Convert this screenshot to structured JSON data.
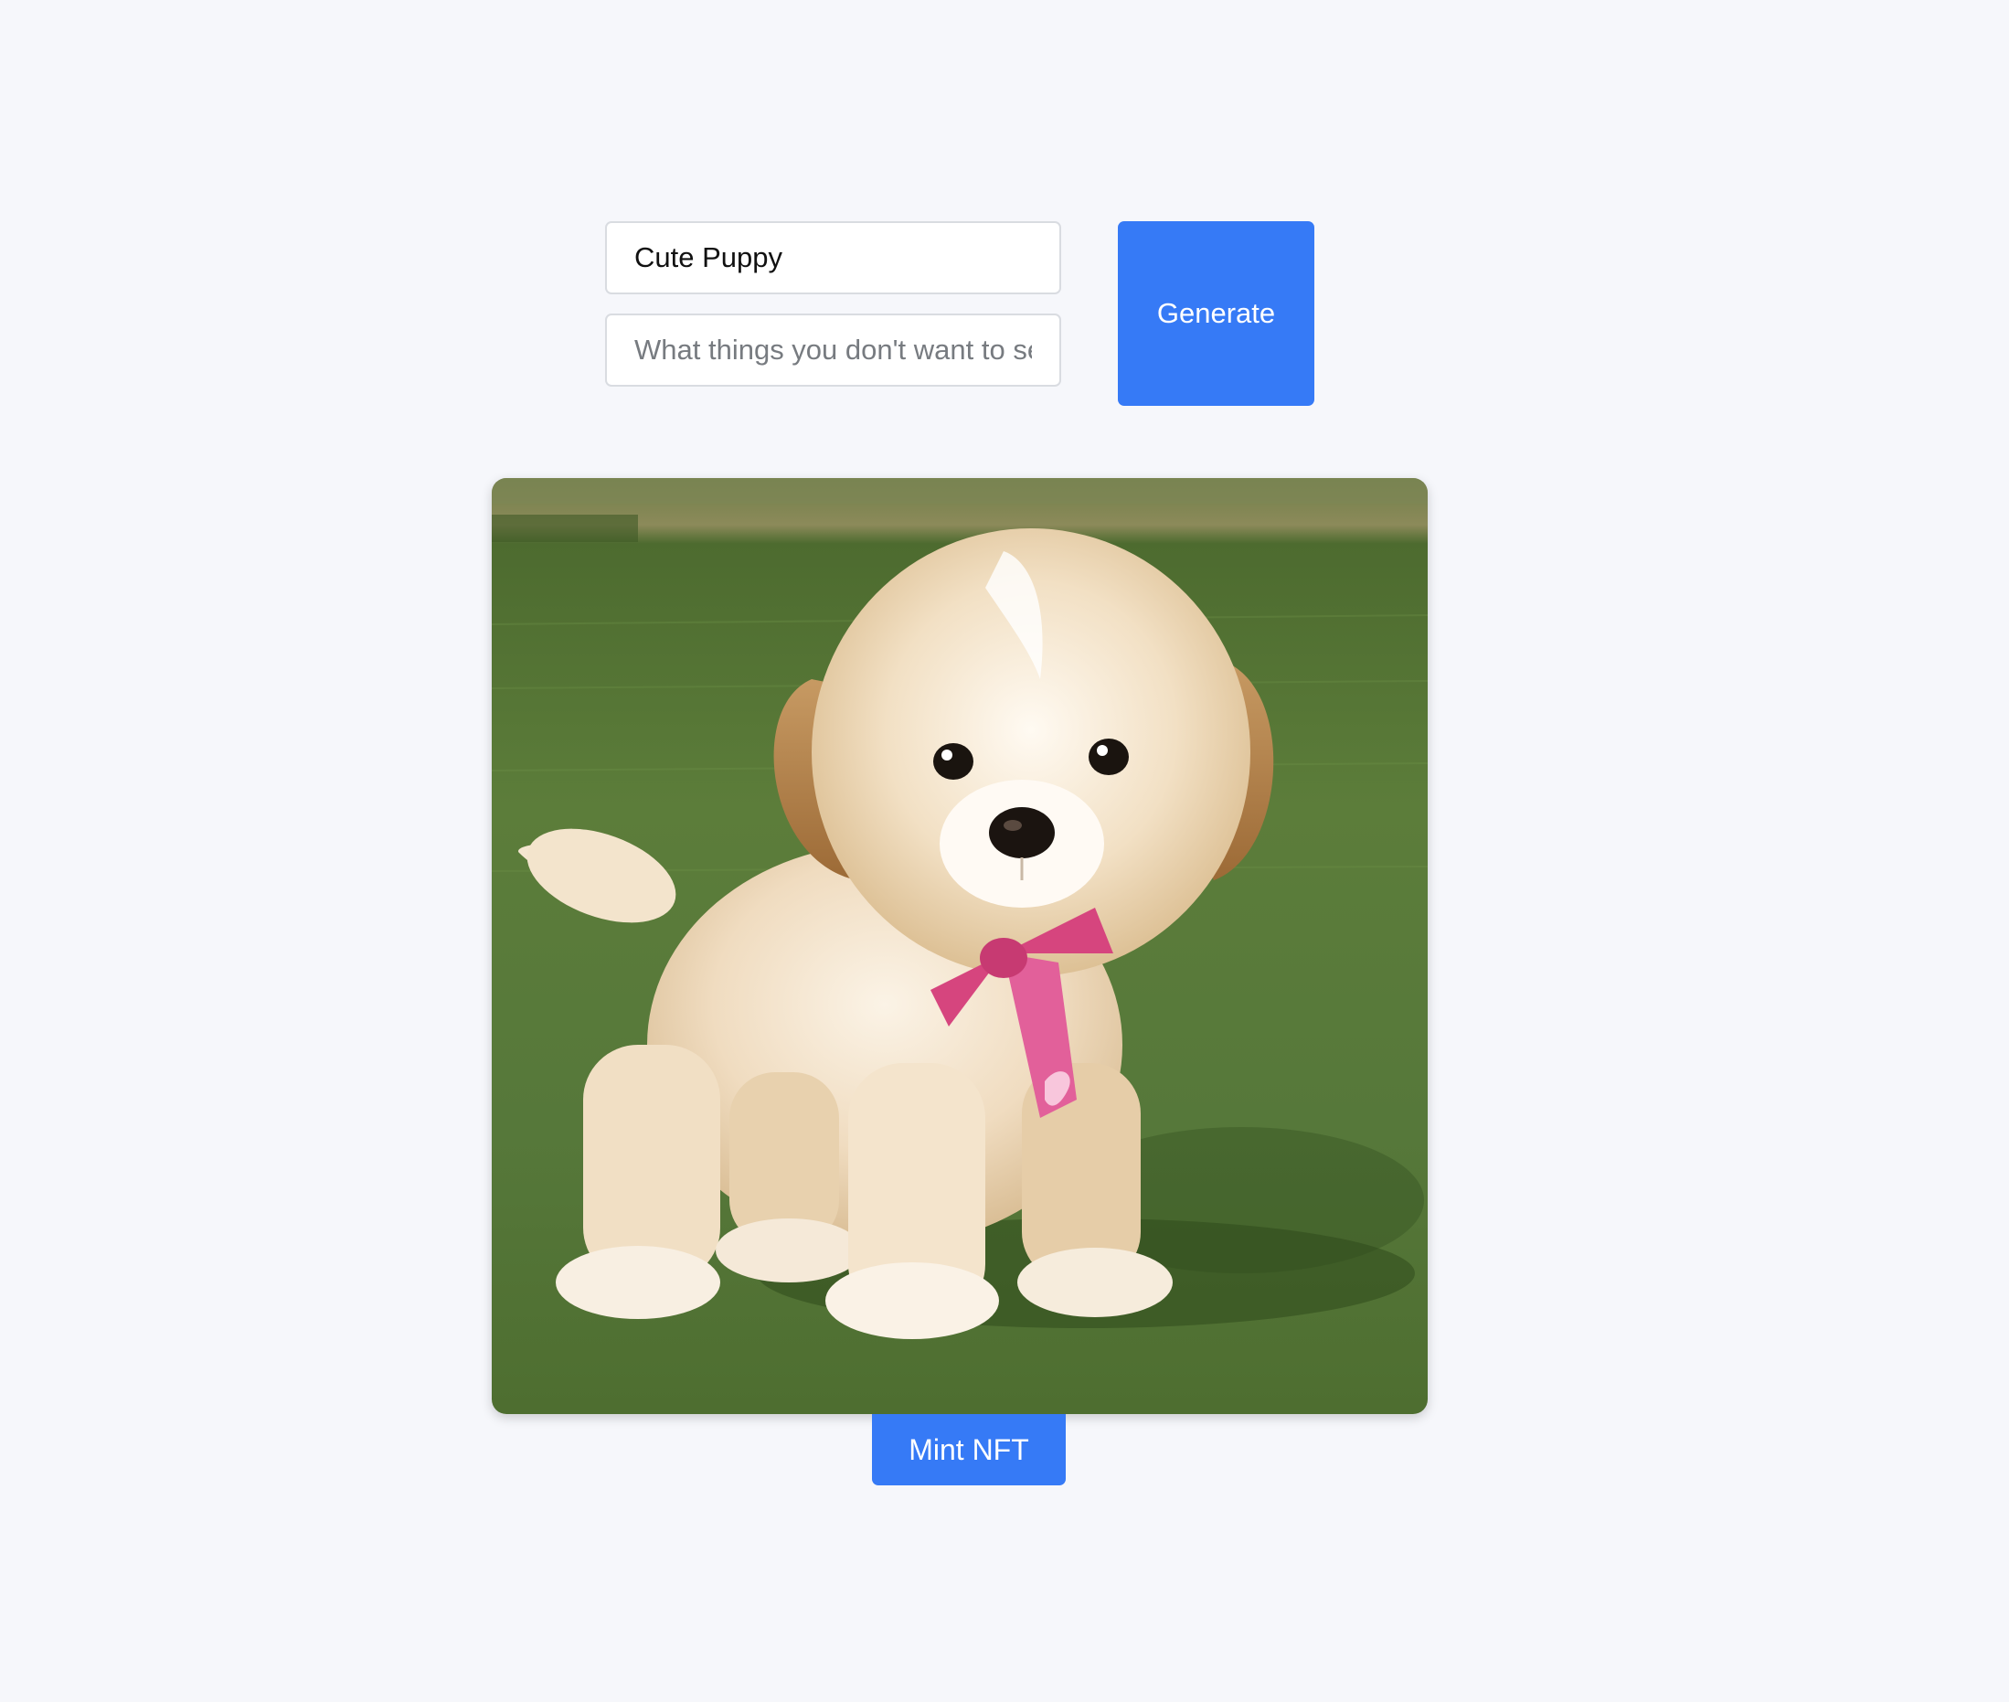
{
  "form": {
    "prompt_value": "Cute Puppy",
    "negative_prompt_value": "",
    "negative_prompt_placeholder": "What things you don't want to see in the image?",
    "generate_label": "Generate"
  },
  "result": {
    "image_subject": "fluffy cream puppy with brown ears and pink ribbon standing on grass",
    "mint_label": "Mint NFT"
  },
  "colors": {
    "background": "#f6f7fb",
    "primary_button": "#367af6",
    "input_border": "#d9dce1",
    "grass": "#5a7a3a",
    "ribbon": "#d6457e"
  }
}
